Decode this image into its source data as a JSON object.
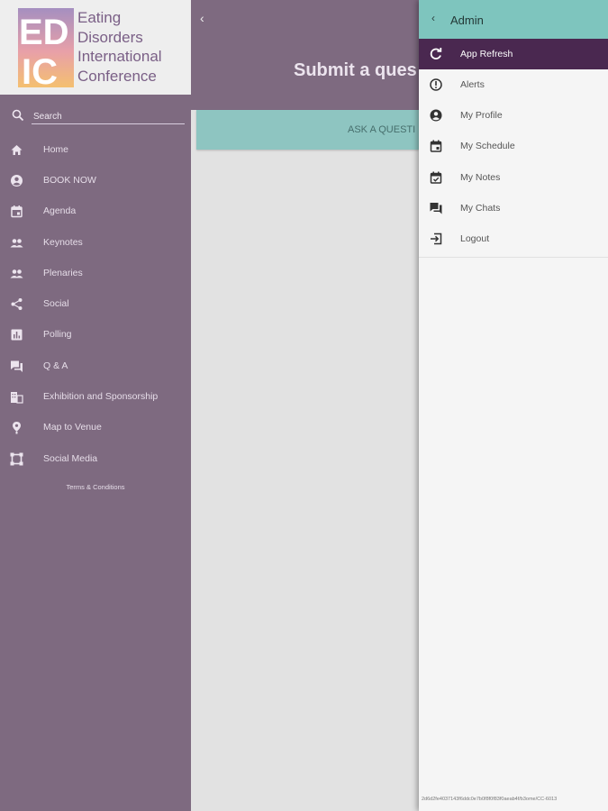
{
  "logo": {
    "mark_top": "ED",
    "mark_bottom": "IC",
    "lines": [
      "Eating",
      "Disorders",
      "International",
      "Conference"
    ]
  },
  "search": {
    "placeholder": "Search"
  },
  "nav": [
    {
      "label": "Home",
      "icon": "home-icon"
    },
    {
      "label": "BOOK NOW",
      "icon": "account-circle-icon"
    },
    {
      "label": "Agenda",
      "icon": "calendar-icon"
    },
    {
      "label": "Keynotes",
      "icon": "people-icon"
    },
    {
      "label": "Plenaries",
      "icon": "people-icon"
    },
    {
      "label": "Social",
      "icon": "share-icon"
    },
    {
      "label": "Polling",
      "icon": "poll-icon"
    },
    {
      "label": "Q & A",
      "icon": "forum-icon"
    },
    {
      "label": "Exhibition and Sponsorship",
      "icon": "business-icon"
    },
    {
      "label": "Map to Venue",
      "icon": "map-pin-icon"
    },
    {
      "label": "Social Media",
      "icon": "social-media-icon"
    }
  ],
  "terms": "Terms & Conditions",
  "main": {
    "back": "‹",
    "title": "Submit a ques",
    "ask_button": "ASK A QUESTI"
  },
  "drawer": {
    "title": "Admin",
    "items": [
      {
        "label": "App Refresh",
        "icon": "refresh-icon",
        "active": true
      },
      {
        "label": "Alerts",
        "icon": "alert-icon"
      },
      {
        "label": "My Profile",
        "icon": "account-circle-icon"
      },
      {
        "label": "My Schedule",
        "icon": "calendar-icon"
      },
      {
        "label": "My Notes",
        "icon": "notes-icon"
      },
      {
        "label": "My Chats",
        "icon": "forum-icon"
      },
      {
        "label": "Logout",
        "icon": "logout-icon"
      }
    ],
    "build": "2d6d2fe4037143f6ddc0e7b0f8f0f83f0aeab4f/b3ome/CC-6013"
  },
  "colors": {
    "sidebar": "#7e6a80",
    "accent_teal": "#8ec5c1",
    "drawer_active": "#4a2850"
  }
}
